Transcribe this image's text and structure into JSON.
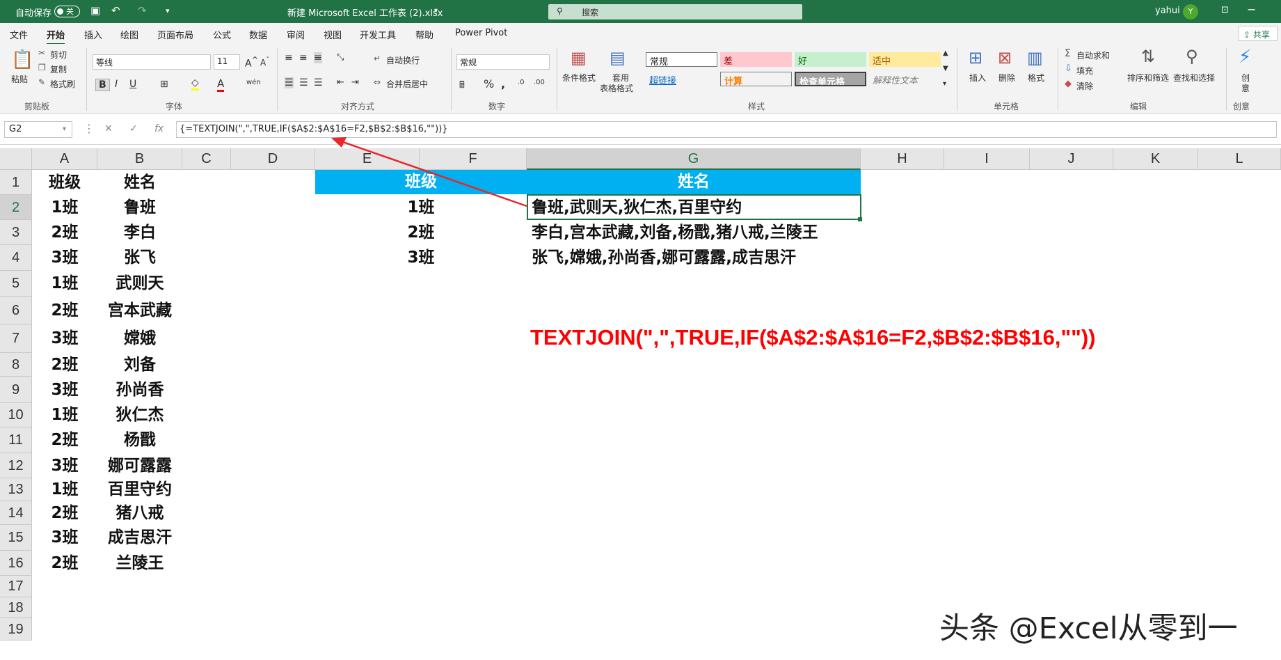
{
  "titlebar": {
    "autosave_label": "自动保存",
    "autosave_state": "关",
    "file_title": "新建 Microsoft Excel 工作表 (2).xlsx",
    "search_placeholder": "搜索",
    "user_name": "yahui",
    "avatar_initial": "Y"
  },
  "tabs": [
    "文件",
    "开始",
    "插入",
    "绘图",
    "页面布局",
    "公式",
    "数据",
    "审阅",
    "视图",
    "开发工具",
    "帮助",
    "Power Pivot"
  ],
  "share_label": "共享",
  "ribbon": {
    "clipboard": {
      "paste": "粘贴",
      "cut": "剪切",
      "copy": "复制",
      "format_painter": "格式刷",
      "group": "剪贴板"
    },
    "font": {
      "name": "等线",
      "size": "11",
      "group": "字体"
    },
    "alignment": {
      "wrap": "自动换行",
      "merge": "合并后居中",
      "group": "对齐方式"
    },
    "number": {
      "format": "常规",
      "group": "数字"
    },
    "styles": {
      "conditional": "条件格式",
      "table_format_1": "套用",
      "table_format_2": "表格格式",
      "normal": "常规",
      "bad": "差",
      "good": "好",
      "neutral": "适中",
      "hyperlink": "超链接",
      "calc": "计算",
      "check_cell": "检查单元格",
      "explanatory": "解释性文本",
      "group": "样式"
    },
    "cells": {
      "insert": "插入",
      "delete": "删除",
      "format": "格式",
      "group": "单元格"
    },
    "editing": {
      "autosum": "自动求和",
      "fill": "填充",
      "clear": "清除",
      "sort": "排序和筛选",
      "find": "查找和选择",
      "group": "编辑"
    },
    "create": {
      "label1": "创",
      "label2": "意",
      "group": "创意"
    }
  },
  "formula_bar": {
    "name_box": "G2",
    "formula": "{=TEXTJOIN(\",\",TRUE,IF($A$2:$A$16=F2,$B$2:$B$16,\"\"))}"
  },
  "columns": [
    "A",
    "B",
    "C",
    "D",
    "E",
    "F",
    "G",
    "H",
    "I",
    "J",
    "K",
    "L"
  ],
  "rows": [
    "1",
    "2",
    "3",
    "4",
    "5",
    "6",
    "7",
    "8",
    "9",
    "10",
    "11",
    "12",
    "13",
    "14",
    "15",
    "16",
    "17",
    "18",
    "19"
  ],
  "table_a": {
    "header_class": "班级",
    "header_name": "姓名",
    "classes": [
      "1班",
      "2班",
      "3班",
      "1班",
      "2班",
      "3班",
      "2班",
      "3班",
      "1班",
      "2班",
      "3班",
      "1班",
      "2班",
      "3班",
      "2班"
    ],
    "names": [
      "鲁班",
      "李白",
      "张飞",
      "武则天",
      "宫本武藏",
      "嫦娥",
      "刘备",
      "孙尚香",
      "狄仁杰",
      "杨戬",
      "娜可露露",
      "百里守约",
      "猪八戒",
      "成吉思汗",
      "兰陵王"
    ]
  },
  "table_f": {
    "header_class": "班级",
    "header_name": "姓名",
    "classes": [
      "1班",
      "2班",
      "3班"
    ],
    "joined": [
      "鲁班,武则天,狄仁杰,百里守约",
      "李白,宫本武藏,刘备,杨戬,猪八戒,兰陵王",
      "张飞,嫦娥,孙尚香,娜可露露,成吉思汗"
    ]
  },
  "annotation_formula": "TEXTJOIN(\",\",TRUE,IF($A$2:$A$16=F2,$B$2:$B$16,\"\"))",
  "watermark": "头条 @Excel从零到一",
  "colors": {
    "excel_green": "#217346",
    "header_fill": "#00b0f0",
    "annotation_red": "#ff0000"
  }
}
